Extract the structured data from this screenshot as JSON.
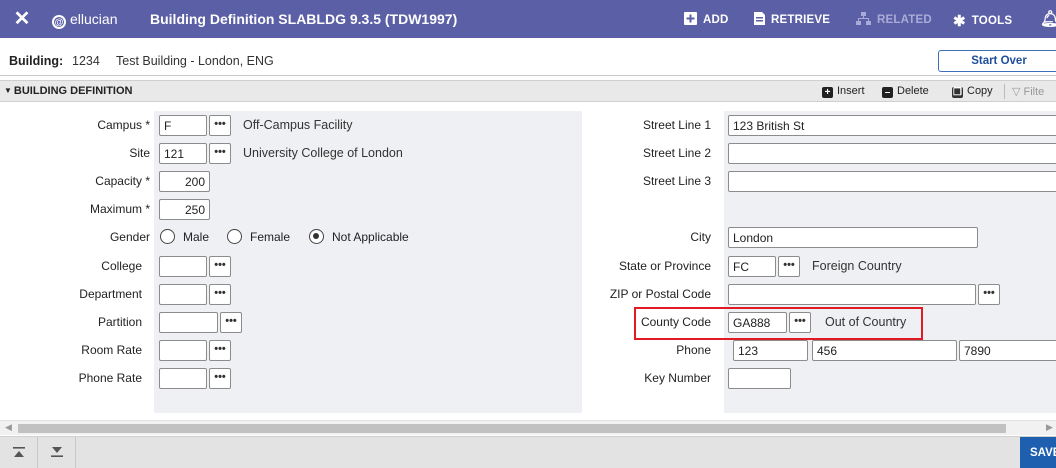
{
  "app": {
    "brand": "ellucian",
    "title": "Building Definition SLABLDG 9.3.5 (TDW1997)"
  },
  "toolbar": {
    "add": "ADD",
    "retrieve": "RETRIEVE",
    "related": "RELATED",
    "tools": "TOOLS"
  },
  "key": {
    "label": "Building:",
    "code": "1234",
    "name": "Test Building - London, ENG",
    "start_over": "Start Over"
  },
  "section": {
    "title": "BUILDING DEFINITION",
    "insert": "Insert",
    "delete": "Delete",
    "copy": "Copy",
    "filter": "Filte"
  },
  "left": {
    "campus": {
      "label": "Campus *",
      "value": "F",
      "desc": "Off-Campus Facility"
    },
    "site": {
      "label": "Site",
      "value": "121",
      "desc": "University College of London"
    },
    "capacity": {
      "label": "Capacity *",
      "value": "200"
    },
    "maximum": {
      "label": "Maximum *",
      "value": "250"
    },
    "gender": {
      "label": "Gender",
      "options": [
        "Male",
        "Female",
        "Not Applicable"
      ],
      "selected": "Not Applicable"
    },
    "college": {
      "label": "College",
      "value": ""
    },
    "department": {
      "label": "Department",
      "value": ""
    },
    "partition": {
      "label": "Partition",
      "value": ""
    },
    "room_rate": {
      "label": "Room Rate",
      "value": ""
    },
    "phone_rate": {
      "label": "Phone Rate",
      "value": ""
    }
  },
  "right": {
    "street1": {
      "label": "Street Line 1",
      "value": "123 British St"
    },
    "street2": {
      "label": "Street Line 2",
      "value": ""
    },
    "street3": {
      "label": "Street Line 3",
      "value": ""
    },
    "city": {
      "label": "City",
      "value": "London"
    },
    "state": {
      "label": "State or Province",
      "value": "FC",
      "desc": "Foreign Country"
    },
    "zip": {
      "label": "ZIP or Postal Code",
      "value": ""
    },
    "county": {
      "label": "County Code",
      "value": "GA888",
      "desc": "Out of Country"
    },
    "phone": {
      "label": "Phone",
      "area": "123",
      "number": "456",
      "ext": "7890"
    },
    "key_number": {
      "label": "Key Number",
      "value": ""
    }
  },
  "footer": {
    "save": "SAVE"
  },
  "colors": {
    "topbar": "#5b5fa6",
    "highlight": "#e01b24",
    "save_button": "#1f5fb0"
  }
}
